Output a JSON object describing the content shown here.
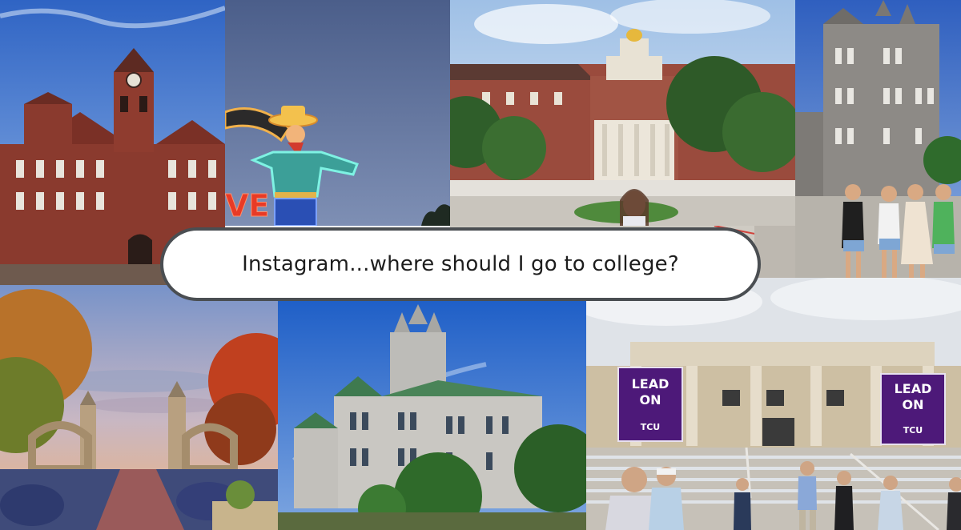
{
  "caption": {
    "text": "Instagram...where should I go to college?"
  },
  "photos": {
    "neon_sign_text": "VE",
    "banner_left_text_1": "LEAD",
    "banner_left_text_2": "ON",
    "banner_left_logo": "TCU",
    "banner_right_text_1": "LEAD",
    "banner_right_text_2": "ON",
    "banner_right_logo": "TCU"
  },
  "colors": {
    "caption_border": "#4a4e52",
    "tcu_purple": "#4d1979",
    "brick": "#8a3a2e",
    "sky": "#3f74c9"
  }
}
